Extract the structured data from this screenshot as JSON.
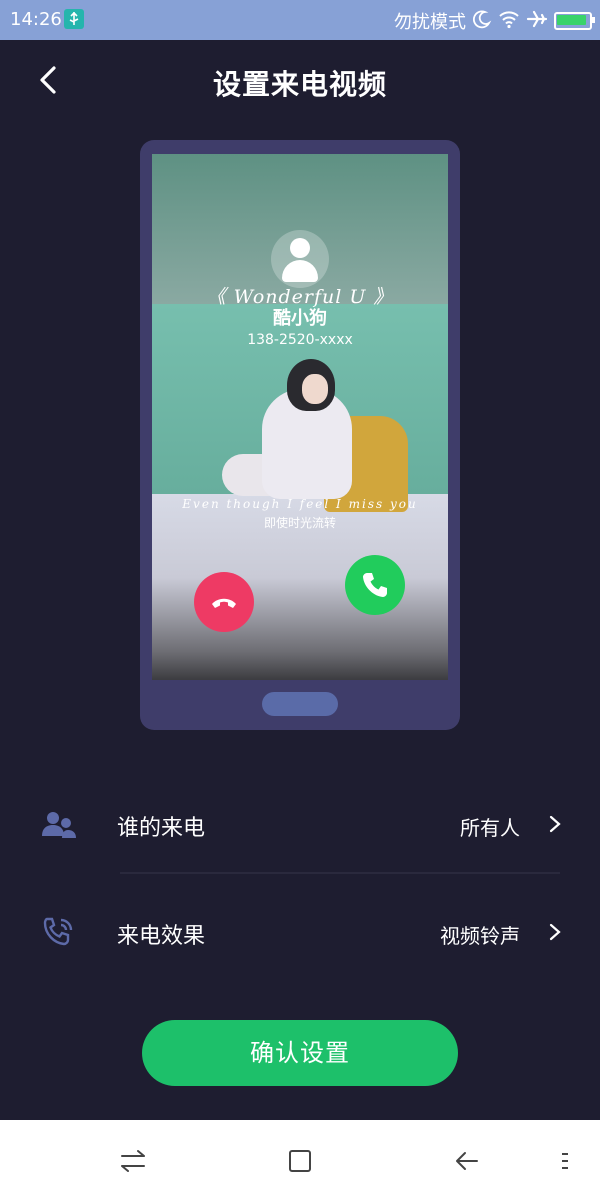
{
  "status_bar": {
    "time": "14:26",
    "mode_text": "勿扰模式",
    "battery_level": 0.9
  },
  "header": {
    "title": "设置来电视频"
  },
  "preview": {
    "song_title": "《 Wonderful U 》",
    "caller_name": "酷小狗",
    "caller_number": "138-2520-xxxx",
    "overlay_line1": "Even though I feel I miss you",
    "overlay_line2": "即使时光流转"
  },
  "settings": {
    "who_label": "谁的来电",
    "who_value": "所有人",
    "effect_label": "来电效果",
    "effect_value": "视频铃声"
  },
  "confirm_label": "确认设置",
  "colors": {
    "background": "#1e1d30",
    "status_bar": "#87a1d6",
    "accent_green": "#1dc06a",
    "decline_red": "#ee3a64",
    "phone_frame": "#3f3d6a"
  },
  "icons": {
    "back": "chevron-left-icon",
    "who": "people-icon",
    "effect": "phone-ring-icon",
    "decline": "hang-up-icon",
    "accept": "phone-icon"
  }
}
